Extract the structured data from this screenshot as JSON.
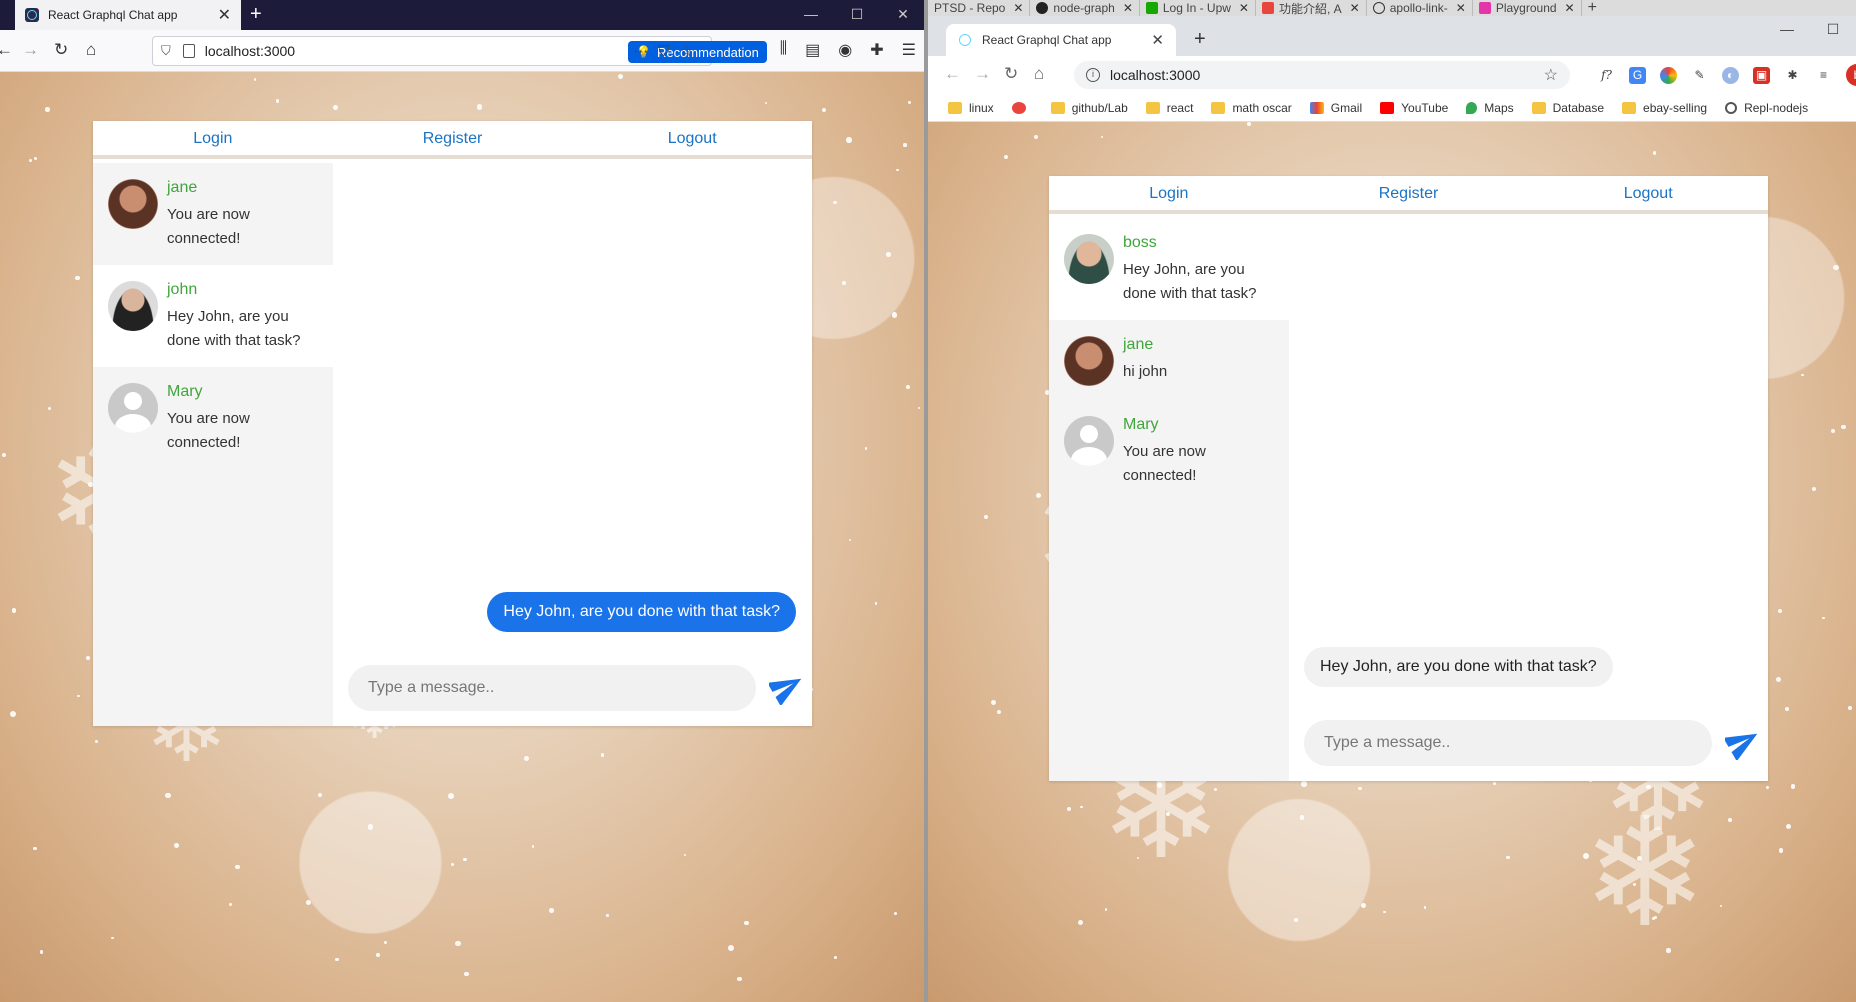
{
  "left_window": {
    "tab_title": "React Graphql Chat app",
    "url": "localhost:3000",
    "recommendation_label": "Recommendation"
  },
  "right_window": {
    "tab_title": "React Graphql Chat app",
    "url": "localhost:3000",
    "background_tabs": [
      "PTSD - Repo",
      "node-graph",
      "Log In - Upw",
      "功能介紹, A",
      "apollo-link-",
      "Playground"
    ],
    "profile_initial": "b",
    "bookmarks": [
      "linux",
      "github/Lab",
      "react",
      "math oscar",
      "Gmail",
      "YouTube",
      "Maps",
      "Database",
      "ebay-selling",
      "Repl-nodejs"
    ]
  },
  "colors": {
    "link_blue": "#1a73c6",
    "name_green": "#3fa63c",
    "bubble_blue": "#1a73e8",
    "firefox_tabbar": "#1d1b3a"
  },
  "app_left": {
    "nav": {
      "login": "Login",
      "register": "Register",
      "logout": "Logout"
    },
    "conversations": [
      {
        "name": "jane",
        "preview": "You are now connected!",
        "avatar": "jane-avatar"
      },
      {
        "name": "john",
        "preview": "Hey John, are you done with that task?",
        "avatar": "john-avatar",
        "active": true
      },
      {
        "name": "Mary",
        "preview": "You are now connected!",
        "avatar": "default-avatar"
      }
    ],
    "message": "Hey John, are you done with that task?",
    "compose_placeholder": "Type a message.."
  },
  "app_right": {
    "nav": {
      "login": "Login",
      "register": "Register",
      "logout": "Logout"
    },
    "conversations": [
      {
        "name": "boss",
        "preview": "Hey John, are you done with that task?",
        "avatar": "boss-avatar",
        "active": true
      },
      {
        "name": "jane",
        "preview": "hi john",
        "avatar": "jane-avatar"
      },
      {
        "name": "Mary",
        "preview": "You are now connected!",
        "avatar": "default-avatar"
      }
    ],
    "message": "Hey John, are you done with that task?",
    "compose_placeholder": "Type a message.."
  }
}
